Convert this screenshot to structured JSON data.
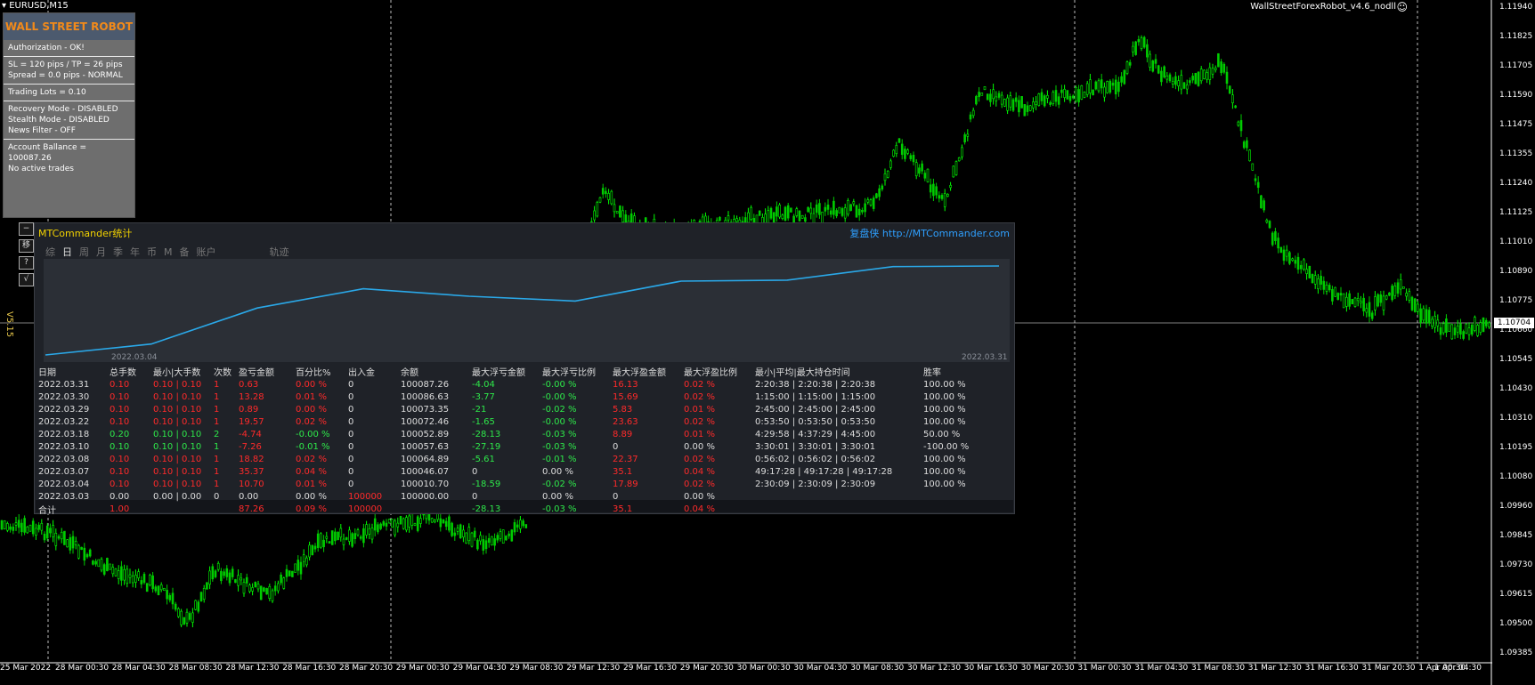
{
  "symbol": "EURUSD,M15",
  "ea_name": "WallStreetForexRobot_v4.6_nodll",
  "ea_smile": "☺",
  "version": "V5.15",
  "robot": {
    "title": "WALL STREET ROBOT",
    "sections": [
      [
        "Authorization - OK!"
      ],
      [
        "SL = 120 pips / TP = 26 pips",
        "Spread = 0.0 pips - NORMAL"
      ],
      [
        "Trading Lots = 0.10"
      ],
      [
        "Recovery Mode - DISABLED",
        "Stealth Mode - DISABLED",
        "News Filter - OFF"
      ],
      [
        "Account Ballance = 100087.26",
        "No active trades"
      ]
    ]
  },
  "side_buttons": [
    "−",
    "移",
    "?",
    "√"
  ],
  "price_axis": {
    "ticks": [
      "1.11940",
      "1.11825",
      "1.11705",
      "1.11590",
      "1.11475",
      "1.11355",
      "1.11240",
      "1.11125",
      "1.11010",
      "1.10890",
      "1.10775",
      "1.10660",
      "1.10545",
      "1.10430",
      "1.10310",
      "1.10195",
      "1.10080",
      "1.09960",
      "1.09845",
      "1.09730",
      "1.09615",
      "1.09500",
      "1.09385"
    ],
    "current": "1.10704"
  },
  "time_axis": [
    "25 Mar 2022",
    "28 Mar 00:30",
    "28 Mar 04:30",
    "28 Mar 08:30",
    "28 Mar 12:30",
    "28 Mar 16:30",
    "28 Mar 20:30",
    "29 Mar 00:30",
    "29 Mar 04:30",
    "29 Mar 08:30",
    "29 Mar 12:30",
    "29 Mar 16:30",
    "29 Mar 20:30",
    "30 Mar 00:30",
    "30 Mar 04:30",
    "30 Mar 08:30",
    "30 Mar 12:30",
    "30 Mar 16:30",
    "30 Mar 20:30",
    "31 Mar 00:30",
    "31 Mar 04:30",
    "31 Mar 08:30",
    "31 Mar 12:30",
    "31 Mar 16:30",
    "31 Mar 20:30",
    "1 Apr 00:30",
    "1 Apr 04:30"
  ],
  "colors": {
    "bull": "#00ff00",
    "bear": "#00cc00",
    "accent_line": "#2aa8e8"
  },
  "mtc": {
    "title": "MTCommander统计",
    "site": "复盘侠 http://MTCommander.com",
    "tabs": [
      "综",
      "日",
      "周",
      "月",
      "季",
      "年",
      "币",
      "M",
      "备",
      "账户",
      "轨迹"
    ],
    "active_tab": 1,
    "graph_start": "2022.03.04",
    "graph_end": "2022.03.31",
    "balance_curve": [
      100000.0,
      100010.7,
      100046.07,
      100064.89,
      100057.63,
      100052.89,
      100072.46,
      100073.35,
      100086.63,
      100087.26
    ],
    "headers": [
      "日期",
      "总手数",
      "最小|大手数",
      "次数",
      "盈亏金额",
      "百分比%",
      "出入金",
      "余额",
      "最大浮亏金额",
      "最大浮亏比例",
      "最大浮盈金额",
      "最大浮盈比例",
      "最小|平均|最大持仓时间",
      "胜率"
    ],
    "rows": [
      {
        "date": "2022.03.31",
        "lots": "0.10",
        "minmax": "0.10 | 0.10",
        "count": "1",
        "pl": "0.63",
        "pct": "0.00 %",
        "flow": "0",
        "balance": "100087.26",
        "maxloss": "-4.04",
        "maxlosspct": "-0.00 %",
        "maxprofit": "16.13",
        "maxprofitpct": "0.02 %",
        "time": "2:20:38 | 2:20:38 | 2:20:38",
        "win": "100.00 %",
        "kind": "red"
      },
      {
        "date": "2022.03.30",
        "lots": "0.10",
        "minmax": "0.10 | 0.10",
        "count": "1",
        "pl": "13.28",
        "pct": "0.01 %",
        "flow": "0",
        "balance": "100086.63",
        "maxloss": "-3.77",
        "maxlosspct": "-0.00 %",
        "maxprofit": "15.69",
        "maxprofitpct": "0.02 %",
        "time": "1:15:00 | 1:15:00 | 1:15:00",
        "win": "100.00 %",
        "kind": "red"
      },
      {
        "date": "2022.03.29",
        "lots": "0.10",
        "minmax": "0.10 | 0.10",
        "count": "1",
        "pl": "0.89",
        "pct": "0.00 %",
        "flow": "0",
        "balance": "100073.35",
        "maxloss": "-21",
        "maxlosspct": "-0.02 %",
        "maxprofit": "5.83",
        "maxprofitpct": "0.01 %",
        "time": "2:45:00 | 2:45:00 | 2:45:00",
        "win": "100.00 %",
        "kind": "red"
      },
      {
        "date": "2022.03.22",
        "lots": "0.10",
        "minmax": "0.10 | 0.10",
        "count": "1",
        "pl": "19.57",
        "pct": "0.02 %",
        "flow": "0",
        "balance": "100072.46",
        "maxloss": "-1.65",
        "maxlosspct": "-0.00 %",
        "maxprofit": "23.63",
        "maxprofitpct": "0.02 %",
        "time": "0:53:50 | 0:53:50 | 0:53:50",
        "win": "100.00 %",
        "kind": "red"
      },
      {
        "date": "2022.03.18",
        "lots": "0.20",
        "minmax": "0.10 | 0.10",
        "count": "2",
        "pl": "-4.74",
        "pct": "-0.00 %",
        "flow": "0",
        "balance": "100052.89",
        "maxloss": "-28.13",
        "maxlosspct": "-0.03 %",
        "maxprofit": "8.89",
        "maxprofitpct": "0.01 %",
        "time": "4:29:58 | 4:37:29 | 4:45:00",
        "win": "50.00 %",
        "kind": "grn"
      },
      {
        "date": "2022.03.10",
        "lots": "0.10",
        "minmax": "0.10 | 0.10",
        "count": "1",
        "pl": "-7.26",
        "pct": "-0.01 %",
        "flow": "0",
        "balance": "100057.63",
        "maxloss": "-27.19",
        "maxlosspct": "-0.03 %",
        "maxprofit": "0",
        "maxprofitpct": "0.00 %",
        "time": "3:30:01 | 3:30:01 | 3:30:01",
        "win": "-100.00 %",
        "kind": "grn"
      },
      {
        "date": "2022.03.08",
        "lots": "0.10",
        "minmax": "0.10 | 0.10",
        "count": "1",
        "pl": "18.82",
        "pct": "0.02 %",
        "flow": "0",
        "balance": "100064.89",
        "maxloss": "-5.61",
        "maxlosspct": "-0.01 %",
        "maxprofit": "22.37",
        "maxprofitpct": "0.02 %",
        "time": "0:56:02 | 0:56:02 | 0:56:02",
        "win": "100.00 %",
        "kind": "red"
      },
      {
        "date": "2022.03.07",
        "lots": "0.10",
        "minmax": "0.10 | 0.10",
        "count": "1",
        "pl": "35.37",
        "pct": "0.04 %",
        "flow": "0",
        "balance": "100046.07",
        "maxloss": "0",
        "maxlosspct": "0.00 %",
        "maxprofit": "35.1",
        "maxprofitpct": "0.04 %",
        "time": "49:17:28 | 49:17:28 | 49:17:28",
        "win": "100.00 %",
        "kind": "red"
      },
      {
        "date": "2022.03.04",
        "lots": "0.10",
        "minmax": "0.10 | 0.10",
        "count": "1",
        "pl": "10.70",
        "pct": "0.01 %",
        "flow": "0",
        "balance": "100010.70",
        "maxloss": "-18.59",
        "maxlosspct": "-0.02 %",
        "maxprofit": "17.89",
        "maxprofitpct": "0.02 %",
        "time": "2:30:09 | 2:30:09 | 2:30:09",
        "win": "100.00 %",
        "kind": "red"
      },
      {
        "date": "2022.03.03",
        "lots": "0.00",
        "minmax": "0.00 | 0.00",
        "count": "0",
        "pl": "0.00",
        "pct": "0.00 %",
        "flow": "100000",
        "balance": "100000.00",
        "maxloss": "0",
        "maxlosspct": "0.00 %",
        "maxprofit": "0",
        "maxprofitpct": "0.00 %",
        "time": "",
        "win": "",
        "kind": "wht"
      }
    ],
    "total": {
      "label": "合计",
      "lots": "1.00",
      "pl": "87.26",
      "pct": "0.09 %",
      "flow": "100000",
      "maxloss": "-28.13",
      "maxlosspct": "-0.03 %",
      "maxprofit": "35.1",
      "maxprofitpct": "0.04 %"
    }
  }
}
